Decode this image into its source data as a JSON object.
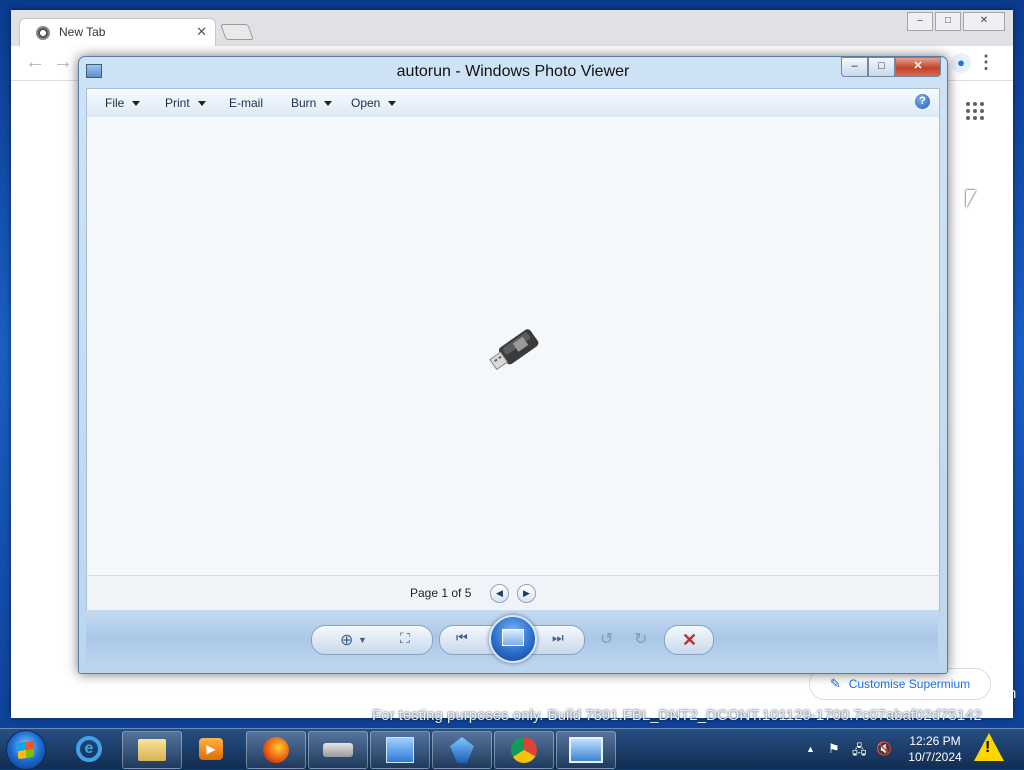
{
  "browser": {
    "tab_title": "New Tab",
    "tab_close": "✕",
    "customise_label": "Customise Supermium"
  },
  "photo_viewer": {
    "title": "autorun - Windows Photo Viewer",
    "menu": [
      "File",
      "Print",
      "E-mail",
      "Burn",
      "Open"
    ],
    "help": "?",
    "page_label": "Page 1 of 5",
    "image_icon": "usb-drive-icon"
  },
  "watermark": "For testing purposes only. Build 7891.FBL_DNT2_DCONT.101129-1700.7c07abaf02d75142",
  "watermark_edge": "n",
  "taskbar": {
    "time": "12:26 PM",
    "date": "10/7/2024",
    "apps": [
      "internet-explorer",
      "windows-explorer",
      "media-player",
      "firefox",
      "drive",
      "control-panel",
      "network",
      "chrome",
      "photo-viewer"
    ]
  }
}
